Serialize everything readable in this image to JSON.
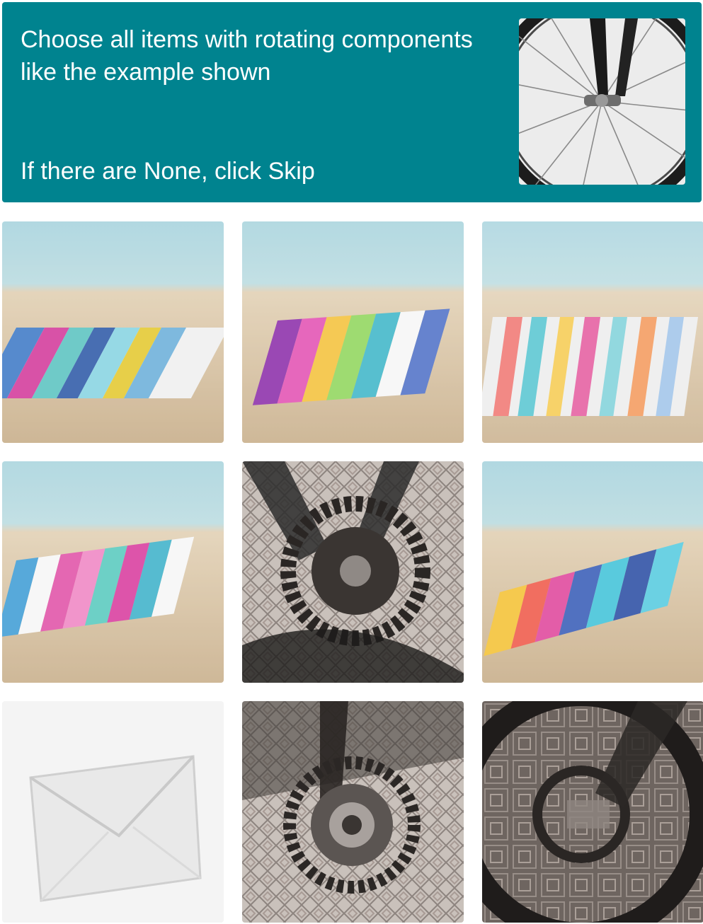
{
  "challenge": {
    "prompt": "Choose all items with rotating components like the example shown",
    "skip_hint": "If there are None, click Skip",
    "example_icon": "bicycle-wheel-hub-icon",
    "header_color": "#00838f"
  },
  "tiles": [
    {
      "subject": "beach-towel-icon"
    },
    {
      "subject": "beach-towel-icon"
    },
    {
      "subject": "beach-towel-icon"
    },
    {
      "subject": "beach-towel-icon"
    },
    {
      "subject": "bicycle-crankset-icon"
    },
    {
      "subject": "beach-towel-icon"
    },
    {
      "subject": "envelope-icon"
    },
    {
      "subject": "bicycle-chainring-icon"
    },
    {
      "subject": "bicycle-wheel-icon"
    }
  ]
}
